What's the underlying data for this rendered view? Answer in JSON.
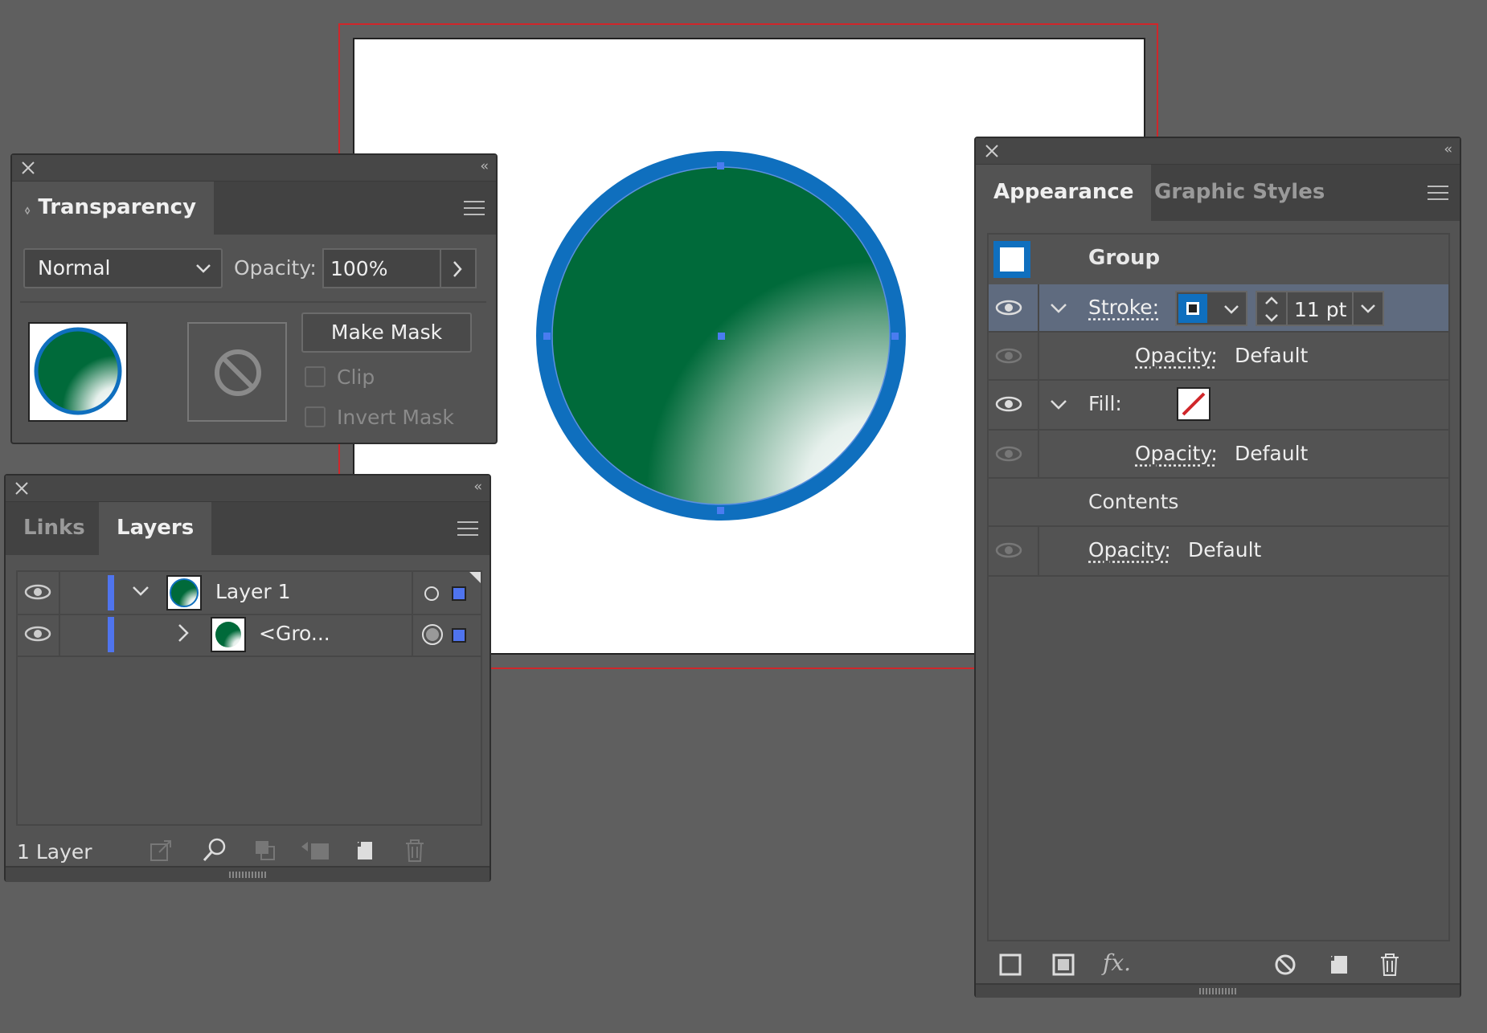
{
  "transparency": {
    "tab_label": "Transparency",
    "blend_mode": "Normal",
    "opacity_label": "Opacity:",
    "opacity_value": "100%",
    "make_mask_label": "Make Mask",
    "clip_label": "Clip",
    "invert_mask_label": "Invert Mask"
  },
  "layers": {
    "tabs": [
      "Links",
      "Layers"
    ],
    "rows": [
      {
        "name": "Layer 1"
      },
      {
        "name": "<Gro..."
      }
    ],
    "footer_count": "1 Layer"
  },
  "appearance": {
    "tabs": [
      "Appearance",
      "Graphic Styles"
    ],
    "group_label": "Group",
    "stroke_label": "Stroke:",
    "stroke_weight": "11 pt",
    "stroke_opacity_label": "Opacity:",
    "stroke_opacity_value": "Default",
    "fill_label": "Fill:",
    "fill_opacity_label": "Opacity:",
    "fill_opacity_value": "Default",
    "contents_label": "Contents",
    "group_opacity_label": "Opacity:",
    "group_opacity_value": "Default",
    "fx_label": "fx."
  },
  "colors": {
    "stroke_blue": "#0f6fbe",
    "fill_green": "#006a3a",
    "selection_blue": "#4a6fb5",
    "bleed_red": "#d0262a"
  },
  "icons": [
    "close-icon",
    "collapse-icon",
    "panel-menu-icon",
    "chevron-down-icon",
    "chevron-right-icon",
    "eye-icon",
    "no-mask-icon",
    "target-icon",
    "trash-icon",
    "new-layer-icon",
    "search-icon"
  ]
}
